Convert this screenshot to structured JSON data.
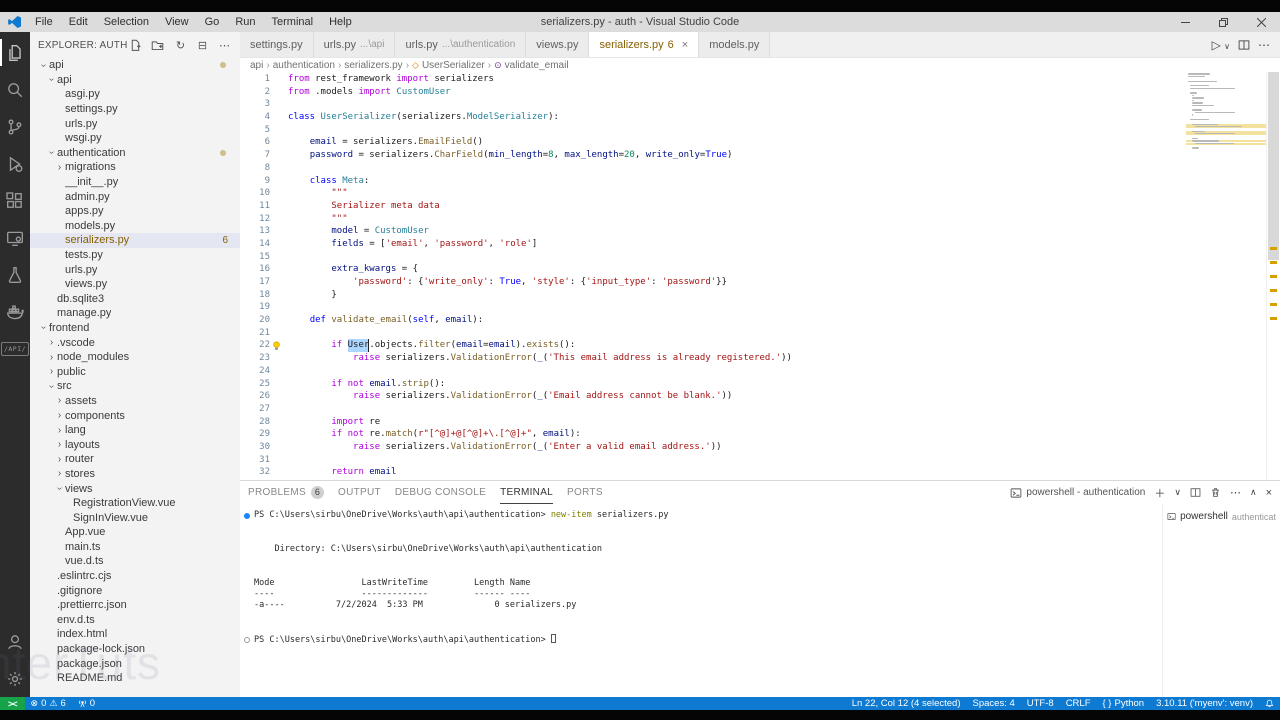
{
  "window": {
    "title": "serializers.py - auth - Visual Studio Code",
    "menus": [
      "File",
      "Edit",
      "Selection",
      "View",
      "Go",
      "Run",
      "Terminal",
      "Help"
    ]
  },
  "activity_bar": {
    "items": [
      {
        "name": "explorer",
        "active": true
      },
      {
        "name": "search"
      },
      {
        "name": "source-control"
      },
      {
        "name": "run-debug"
      },
      {
        "name": "extensions"
      },
      {
        "name": "remote-explorer"
      },
      {
        "name": "testing"
      },
      {
        "name": "docker"
      },
      {
        "name": "rest-api",
        "text": "API"
      }
    ],
    "bottom": [
      {
        "name": "accounts"
      },
      {
        "name": "settings"
      }
    ]
  },
  "explorer": {
    "title": "EXPLORER: AUTH",
    "actions": [
      "new-file",
      "new-folder",
      "refresh",
      "collapse-all",
      "more"
    ],
    "tree": [
      {
        "l": "api",
        "i": 0,
        "c": "open",
        "dot": true
      },
      {
        "l": "api",
        "i": 1,
        "c": "open"
      },
      {
        "l": "asgi.py",
        "i": 2
      },
      {
        "l": "settings.py",
        "i": 2
      },
      {
        "l": "urls.py",
        "i": 2
      },
      {
        "l": "wsgi.py",
        "i": 2
      },
      {
        "l": "authentication",
        "i": 1,
        "c": "open",
        "dot": true
      },
      {
        "l": "migrations",
        "i": 2,
        "c": "closed"
      },
      {
        "l": "__init__.py",
        "i": 2
      },
      {
        "l": "admin.py",
        "i": 2
      },
      {
        "l": "apps.py",
        "i": 2
      },
      {
        "l": "models.py",
        "i": 2
      },
      {
        "l": "serializers.py",
        "i": 2,
        "sel": true,
        "warn": true,
        "badge": "6"
      },
      {
        "l": "tests.py",
        "i": 2
      },
      {
        "l": "urls.py",
        "i": 2
      },
      {
        "l": "views.py",
        "i": 2
      },
      {
        "l": "db.sqlite3",
        "i": 1
      },
      {
        "l": "manage.py",
        "i": 1
      },
      {
        "l": "frontend",
        "i": 0,
        "c": "open"
      },
      {
        "l": ".vscode",
        "i": 1,
        "c": "closed"
      },
      {
        "l": "node_modules",
        "i": 1,
        "c": "closed"
      },
      {
        "l": "public",
        "i": 1,
        "c": "closed"
      },
      {
        "l": "src",
        "i": 1,
        "c": "open"
      },
      {
        "l": "assets",
        "i": 2,
        "c": "closed"
      },
      {
        "l": "components",
        "i": 2,
        "c": "closed"
      },
      {
        "l": "lang",
        "i": 2,
        "c": "closed"
      },
      {
        "l": "layouts",
        "i": 2,
        "c": "closed"
      },
      {
        "l": "router",
        "i": 2,
        "c": "closed"
      },
      {
        "l": "stores",
        "i": 2,
        "c": "closed"
      },
      {
        "l": "views",
        "i": 2,
        "c": "open"
      },
      {
        "l": "RegistrationView.vue",
        "i": 3
      },
      {
        "l": "SignInView.vue",
        "i": 3
      },
      {
        "l": "App.vue",
        "i": 2
      },
      {
        "l": "main.ts",
        "i": 2
      },
      {
        "l": "vue.d.ts",
        "i": 2
      },
      {
        "l": ".eslintrc.cjs",
        "i": 1
      },
      {
        "l": ".gitignore",
        "i": 1
      },
      {
        "l": ".prettierrc.json",
        "i": 1
      },
      {
        "l": "env.d.ts",
        "i": 1
      },
      {
        "l": "index.html",
        "i": 1
      },
      {
        "l": "package-lock.json",
        "i": 1
      },
      {
        "l": "package.json",
        "i": 1
      },
      {
        "l": "README.md",
        "i": 1
      }
    ]
  },
  "tabs": [
    {
      "label": "settings.py"
    },
    {
      "label": "urls.py",
      "desc": "...\\api"
    },
    {
      "label": "urls.py",
      "desc": "...\\authentication"
    },
    {
      "label": "views.py"
    },
    {
      "label": "serializers.py",
      "badge": "6",
      "active": true
    },
    {
      "label": "models.py"
    }
  ],
  "breadcrumb": [
    {
      "label": "api"
    },
    {
      "label": "authentication"
    },
    {
      "label": "serializers.py"
    },
    {
      "label": "UserSerializer",
      "icon": "class"
    },
    {
      "label": "validate_email",
      "icon": "method"
    }
  ],
  "code": {
    "warn_lines": [
      22,
      23,
      25,
      26,
      29,
      30
    ],
    "lines": [
      {
        "n": 1,
        "t": [
          [
            "k",
            "from"
          ],
          [
            "p",
            " rest_framework "
          ],
          [
            "k",
            "import"
          ],
          [
            "p",
            " serializers"
          ]
        ]
      },
      {
        "n": 2,
        "t": [
          [
            "k",
            "from"
          ],
          [
            "p",
            " .models "
          ],
          [
            "k",
            "import"
          ],
          [
            "p",
            " "
          ],
          [
            "t",
            "CustomUser"
          ]
        ]
      },
      {
        "n": 3,
        "t": []
      },
      {
        "n": 4,
        "t": [
          [
            "b",
            "class"
          ],
          [
            "p",
            " "
          ],
          [
            "t",
            "UserSerializer"
          ],
          [
            "p",
            "(serializers."
          ],
          [
            "t",
            "ModelSerializer"
          ],
          [
            "p",
            "):"
          ]
        ]
      },
      {
        "n": 5,
        "t": []
      },
      {
        "n": 6,
        "t": [
          [
            "p",
            "    "
          ],
          [
            "v",
            "email"
          ],
          [
            "p",
            " = serializers."
          ],
          [
            "f",
            "EmailField"
          ],
          [
            "p",
            "()"
          ]
        ]
      },
      {
        "n": 7,
        "t": [
          [
            "p",
            "    "
          ],
          [
            "v",
            "password"
          ],
          [
            "p",
            " = serializers."
          ],
          [
            "f",
            "CharField"
          ],
          [
            "p",
            "("
          ],
          [
            "v",
            "min_length"
          ],
          [
            "p",
            "="
          ],
          [
            "n",
            "8"
          ],
          [
            "p",
            ", "
          ],
          [
            "v",
            "max_length"
          ],
          [
            "p",
            "="
          ],
          [
            "n",
            "20"
          ],
          [
            "p",
            ", "
          ],
          [
            "v",
            "write_only"
          ],
          [
            "p",
            "="
          ],
          [
            "b",
            "True"
          ],
          [
            "p",
            ")"
          ]
        ]
      },
      {
        "n": 8,
        "t": []
      },
      {
        "n": 9,
        "t": [
          [
            "p",
            "    "
          ],
          [
            "b",
            "class"
          ],
          [
            "p",
            " "
          ],
          [
            "t",
            "Meta"
          ],
          [
            "p",
            ":"
          ]
        ]
      },
      {
        "n": 10,
        "t": [
          [
            "p",
            "        "
          ],
          [
            "s",
            "\"\"\""
          ]
        ]
      },
      {
        "n": 11,
        "t": [
          [
            "p",
            "        "
          ],
          [
            "s",
            "Serializer meta data"
          ]
        ]
      },
      {
        "n": 12,
        "t": [
          [
            "p",
            "        "
          ],
          [
            "s",
            "\"\"\""
          ]
        ]
      },
      {
        "n": 13,
        "t": [
          [
            "p",
            "        "
          ],
          [
            "v",
            "model"
          ],
          [
            "p",
            " = "
          ],
          [
            "t",
            "CustomUser"
          ]
        ]
      },
      {
        "n": 14,
        "t": [
          [
            "p",
            "        "
          ],
          [
            "v",
            "fields"
          ],
          [
            "p",
            " = ["
          ],
          [
            "s",
            "'email'"
          ],
          [
            "p",
            ", "
          ],
          [
            "s",
            "'password'"
          ],
          [
            "p",
            ", "
          ],
          [
            "s",
            "'role'"
          ],
          [
            "p",
            "]"
          ]
        ]
      },
      {
        "n": 15,
        "t": []
      },
      {
        "n": 16,
        "t": [
          [
            "p",
            "        "
          ],
          [
            "v",
            "extra_kwargs"
          ],
          [
            "p",
            " = {"
          ]
        ]
      },
      {
        "n": 17,
        "t": [
          [
            "p",
            "            "
          ],
          [
            "s",
            "'password'"
          ],
          [
            "p",
            ": {"
          ],
          [
            "s",
            "'write_only'"
          ],
          [
            "p",
            ": "
          ],
          [
            "b",
            "True"
          ],
          [
            "p",
            ", "
          ],
          [
            "s",
            "'style'"
          ],
          [
            "p",
            ": {"
          ],
          [
            "s",
            "'input_type'"
          ],
          [
            "p",
            ": "
          ],
          [
            "s",
            "'password'"
          ],
          [
            "p",
            "}}"
          ]
        ]
      },
      {
        "n": 18,
        "t": [
          [
            "p",
            "        }"
          ]
        ]
      },
      {
        "n": 19,
        "t": []
      },
      {
        "n": 20,
        "t": [
          [
            "p",
            "    "
          ],
          [
            "b",
            "def"
          ],
          [
            "p",
            " "
          ],
          [
            "f",
            "validate_email"
          ],
          [
            "p",
            "("
          ],
          [
            "b",
            "self"
          ],
          [
            "p",
            ", "
          ],
          [
            "v",
            "email"
          ],
          [
            "p",
            "):"
          ]
        ]
      },
      {
        "n": 21,
        "t": []
      },
      {
        "n": 22,
        "lb": true,
        "t": [
          [
            "p",
            "        "
          ],
          [
            "k",
            "if"
          ],
          [
            "p",
            " "
          ],
          [
            "sel",
            "User"
          ],
          [
            "cur",
            ""
          ],
          [
            "p",
            ".objects."
          ],
          [
            "f",
            "filter"
          ],
          [
            "p",
            "("
          ],
          [
            "v",
            "email"
          ],
          [
            "p",
            "="
          ],
          [
            "v",
            "email"
          ],
          [
            "p",
            ")."
          ],
          [
            "f",
            "exists"
          ],
          [
            "p",
            "():"
          ]
        ]
      },
      {
        "n": 23,
        "t": [
          [
            "p",
            "            "
          ],
          [
            "k",
            "raise"
          ],
          [
            "p",
            " serializers."
          ],
          [
            "f",
            "ValidationError"
          ],
          [
            "p",
            "("
          ],
          [
            "v",
            "_"
          ],
          [
            "p",
            "("
          ],
          [
            "s",
            "'This email address is already registered.'"
          ],
          [
            "p",
            "))"
          ]
        ]
      },
      {
        "n": 24,
        "t": []
      },
      {
        "n": 25,
        "t": [
          [
            "p",
            "        "
          ],
          [
            "k",
            "if"
          ],
          [
            "p",
            " "
          ],
          [
            "k",
            "not"
          ],
          [
            "p",
            " "
          ],
          [
            "v",
            "email"
          ],
          [
            "p",
            "."
          ],
          [
            "f",
            "strip"
          ],
          [
            "p",
            "():"
          ]
        ]
      },
      {
        "n": 26,
        "t": [
          [
            "p",
            "            "
          ],
          [
            "k",
            "raise"
          ],
          [
            "p",
            " serializers."
          ],
          [
            "f",
            "ValidationError"
          ],
          [
            "p",
            "("
          ],
          [
            "v",
            "_"
          ],
          [
            "p",
            "("
          ],
          [
            "s",
            "'Email address cannot be blank.'"
          ],
          [
            "p",
            "))"
          ]
        ]
      },
      {
        "n": 27,
        "t": []
      },
      {
        "n": 28,
        "t": [
          [
            "p",
            "        "
          ],
          [
            "k",
            "import"
          ],
          [
            "p",
            " re"
          ]
        ]
      },
      {
        "n": 29,
        "t": [
          [
            "p",
            "        "
          ],
          [
            "k",
            "if"
          ],
          [
            "p",
            " "
          ],
          [
            "k",
            "not"
          ],
          [
            "p",
            " re."
          ],
          [
            "f",
            "match"
          ],
          [
            "p",
            "("
          ],
          [
            "s",
            "r\"[^@]+@[^@]+\\.[^@]+\""
          ],
          [
            "p",
            ", "
          ],
          [
            "v",
            "email"
          ],
          [
            "p",
            "):"
          ]
        ]
      },
      {
        "n": 30,
        "t": [
          [
            "p",
            "            "
          ],
          [
            "k",
            "raise"
          ],
          [
            "p",
            " serializers."
          ],
          [
            "f",
            "ValidationError"
          ],
          [
            "p",
            "("
          ],
          [
            "v",
            "_"
          ],
          [
            "p",
            "("
          ],
          [
            "s",
            "'Enter a valid email address.'"
          ],
          [
            "p",
            "))"
          ]
        ]
      },
      {
        "n": 31,
        "t": []
      },
      {
        "n": 32,
        "t": [
          [
            "p",
            "        "
          ],
          [
            "k",
            "return"
          ],
          [
            "p",
            " "
          ],
          [
            "v",
            "email"
          ]
        ]
      }
    ]
  },
  "panel": {
    "tabs": [
      {
        "label": "PROBLEMS",
        "badge": "6"
      },
      {
        "label": "OUTPUT"
      },
      {
        "label": "DEBUG CONSOLE"
      },
      {
        "label": "TERMINAL",
        "active": true
      },
      {
        "label": "PORTS"
      }
    ],
    "title": "powershell - authentication",
    "list_item": {
      "label": "powershell",
      "desc": "authenticati..."
    },
    "terminal_lines": [
      {
        "d": "run",
        "t": [
          [
            "p",
            "PS C:\\Users\\sirbu\\OneDrive\\Works\\auth\\api\\authentication> "
          ],
          [
            "cmd",
            "new-item"
          ],
          [
            "p",
            " serializers.py"
          ]
        ]
      },
      {
        "t": []
      },
      {
        "t": []
      },
      {
        "t": [
          [
            "p",
            "    Directory: C:\\Users\\sirbu\\OneDrive\\Works\\auth\\api\\authentication"
          ]
        ]
      },
      {
        "t": []
      },
      {
        "t": []
      },
      {
        "t": [
          [
            "p",
            "Mode                 LastWriteTime         Length Name"
          ]
        ]
      },
      {
        "t": [
          [
            "p",
            "----                 -------------         ------ ----"
          ]
        ]
      },
      {
        "t": [
          [
            "p",
            "-a----          7/2/2024  5:33 PM              0 serializers.py"
          ]
        ]
      },
      {
        "t": []
      },
      {
        "t": []
      },
      {
        "d": "idle",
        "t": [
          [
            "p",
            "PS C:\\Users\\sirbu\\OneDrive\\Works\\auth\\api\\authentication> "
          ],
          [
            "cursor",
            ""
          ]
        ]
      }
    ]
  },
  "statusbar": {
    "errors": "0",
    "warnings": "6",
    "ports": "0",
    "line_col": "Ln 22, Col 12 (4 selected)",
    "spaces": "Spaces: 4",
    "encoding": "UTF-8",
    "eol": "CRLF",
    "language": "Python",
    "interpreter": "3.10.11 ('myenv': venv)",
    "accent": "#0e7ad1",
    "remote_accent": "#16a34a"
  },
  "watermark": "nterTuts"
}
